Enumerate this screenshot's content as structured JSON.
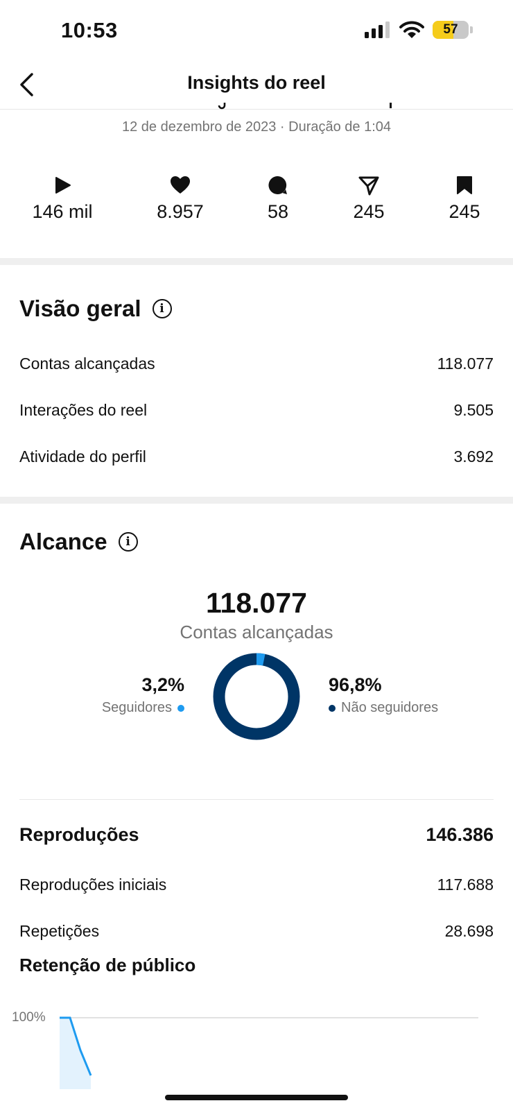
{
  "status_bar": {
    "time": "10:53",
    "battery": "57",
    "battery_level": 0.57,
    "battery_color": "#f5cc1b"
  },
  "header": {
    "title": "Insights do reel",
    "back_icon": "chevron-left-icon"
  },
  "post": {
    "date_line": "12 de dezembro de 2023 · Duração de 1:04"
  },
  "metrics": [
    {
      "icon": "play-icon",
      "value": "146 mil"
    },
    {
      "icon": "heart-icon",
      "value": "8.957"
    },
    {
      "icon": "comment-icon",
      "value": "58"
    },
    {
      "icon": "send-icon",
      "value": "245"
    },
    {
      "icon": "bookmark-icon",
      "value": "245"
    }
  ],
  "overview": {
    "title": "Visão geral",
    "rows": [
      {
        "label": "Contas alcançadas",
        "value": "118.077"
      },
      {
        "label": "Interações do reel",
        "value": "9.505"
      },
      {
        "label": "Atividade do perfil",
        "value": "3.692"
      }
    ]
  },
  "reach": {
    "title": "Alcance",
    "total": "118.077",
    "subtitle": "Contas alcançadas",
    "followers_pct": "3,2%",
    "followers_label": "Seguidores",
    "followers_fraction": 0.032,
    "followers_color": "#1e9bf0",
    "non_followers_pct": "96,8%",
    "non_followers_label": "Não seguidores",
    "non_followers_color": "#003566"
  },
  "plays": {
    "title": "Reproduções",
    "total": "146.386",
    "rows": [
      {
        "label": "Reproduções iniciais",
        "value": "117.688"
      },
      {
        "label": "Repetições",
        "value": "28.698"
      }
    ]
  },
  "retention": {
    "title": "Retenção de público",
    "y_tick": "100%"
  },
  "chart_data": {
    "type": "area",
    "title": "Retenção de público",
    "y_ticks": [
      "100%"
    ],
    "x": [
      0,
      1,
      2,
      3
    ],
    "values": [
      100,
      100,
      82,
      68
    ],
    "line_color": "#1e9bf0",
    "fill_color": "#e3f2fd"
  }
}
